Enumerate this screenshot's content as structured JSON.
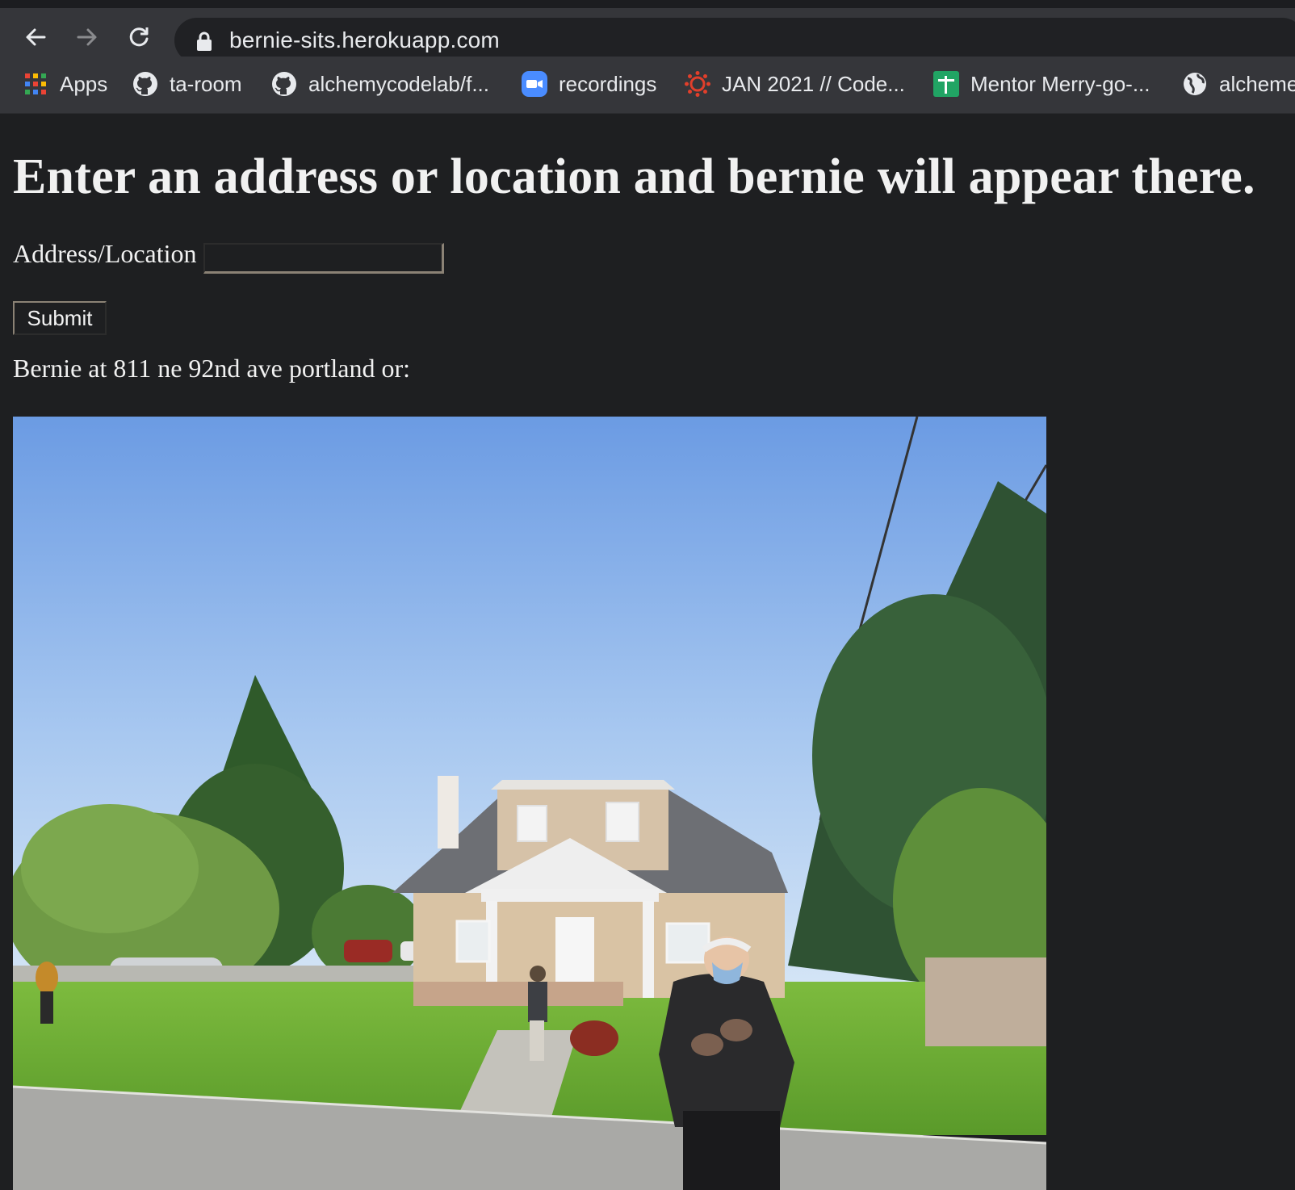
{
  "browser": {
    "url": "bernie-sits.herokuapp.com",
    "bookmarks": [
      {
        "label": "Apps",
        "icon": "apps-grid-icon"
      },
      {
        "label": "ta-room",
        "icon": "github-icon"
      },
      {
        "label": "alchemycodelab/f...",
        "icon": "github-icon"
      },
      {
        "label": "recordings",
        "icon": "zoom-video-icon"
      },
      {
        "label": "JAN 2021 // Code...",
        "icon": "canvas-icon"
      },
      {
        "label": "Mentor Merry-go-...",
        "icon": "google-sheets-icon"
      },
      {
        "label": "alcheme",
        "icon": "globe-icon"
      }
    ]
  },
  "page": {
    "heading": "Enter an address or location and bernie will appear there.",
    "form": {
      "label": "Address/Location",
      "input_value": "",
      "submit_label": "Submit"
    },
    "result_text": "Bernie at 811 ne 92nd ave portland or:",
    "image_description_icon": "street-view-photo"
  }
}
